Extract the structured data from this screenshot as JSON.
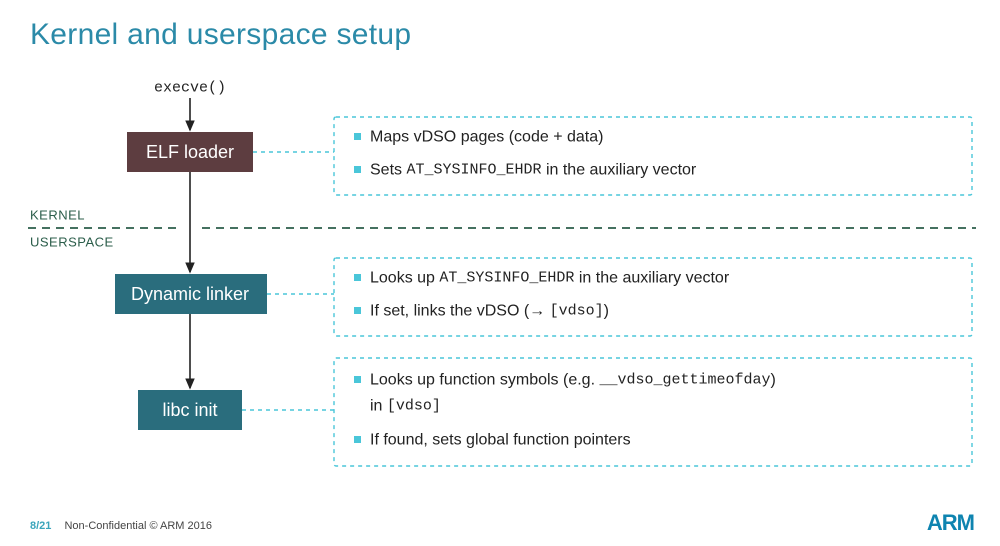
{
  "title": "Kernel and userspace setup",
  "flow": {
    "entry": "execve()",
    "boxes": {
      "elf": "ELF loader",
      "linker": "Dynamic linker",
      "libc": "libc init"
    },
    "regions": {
      "kernel": "KERNEL",
      "userspace": "USERSPACE"
    }
  },
  "panels": {
    "elf": [
      [
        "Maps vDSO pages (code + data)"
      ],
      [
        "Sets ",
        "AT_SYSINFO_EHDR",
        " in the auxiliary vector"
      ]
    ],
    "linker": [
      [
        "Looks up ",
        "AT_SYSINFO_EHDR",
        " in the auxiliary vector"
      ],
      [
        "If set, links the vDSO (→ ",
        "[vdso]",
        ")"
      ]
    ],
    "libc": [
      [
        "Looks up function symbols (e.g. ",
        "__vdso_gettimeofday",
        ")"
      ],
      [
        "   in ",
        "[vdso]",
        ""
      ],
      [
        "If found, sets global function pointers"
      ]
    ]
  },
  "footer": {
    "page": "8/21",
    "text": "Non-Confidential © ARM 2016",
    "logo": "ARM"
  },
  "chart_data": {
    "type": "diagram",
    "title": "Kernel and userspace setup",
    "entrypoint": "execve()",
    "regions": [
      "KERNEL",
      "USERSPACE"
    ],
    "nodes": [
      {
        "id": "elf",
        "label": "ELF loader",
        "region": "KERNEL",
        "description": [
          "Maps vDSO pages (code + data)",
          "Sets AT_SYSINFO_EHDR in the auxiliary vector"
        ]
      },
      {
        "id": "linker",
        "label": "Dynamic linker",
        "region": "USERSPACE",
        "description": [
          "Looks up AT_SYSINFO_EHDR in the auxiliary vector",
          "If set, links the vDSO (→ [vdso])"
        ]
      },
      {
        "id": "libc",
        "label": "libc init",
        "region": "USERSPACE",
        "description": [
          "Looks up function symbols (e.g. __vdso_gettimeofday) in [vdso]",
          "If found, sets global function pointers"
        ]
      }
    ],
    "edges": [
      {
        "from": "execve()",
        "to": "elf"
      },
      {
        "from": "elf",
        "to": "linker"
      },
      {
        "from": "linker",
        "to": "libc"
      }
    ]
  }
}
